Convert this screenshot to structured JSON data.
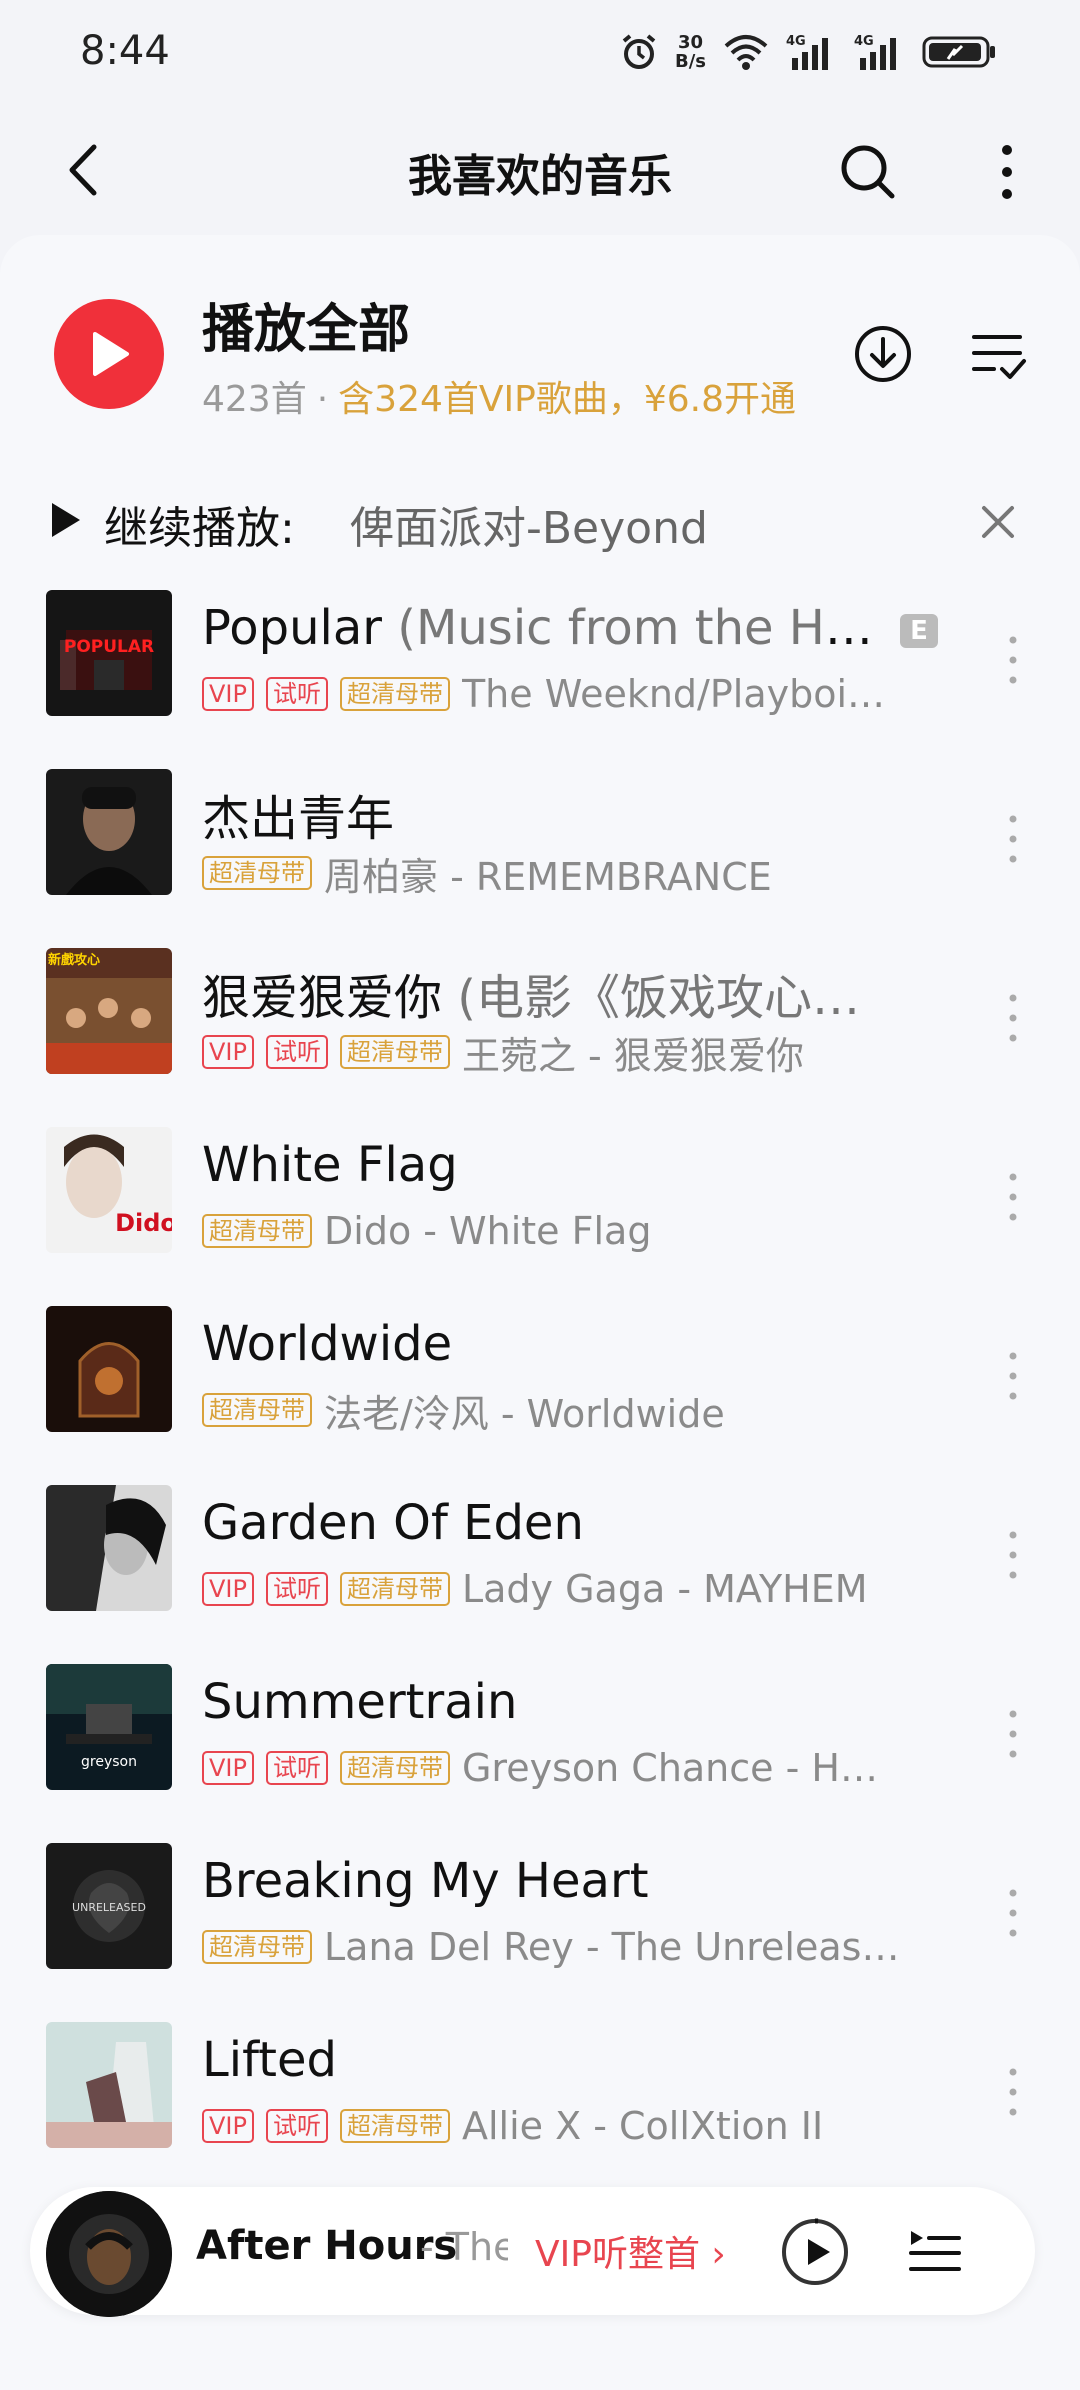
{
  "status_bar": {
    "time": "8:44",
    "net_speed_value": "30",
    "net_speed_unit": "B/s",
    "icons": [
      "alarm-icon",
      "wifi-icon",
      "signal-4g-icon",
      "signal-4g-icon",
      "battery-icon"
    ]
  },
  "nav": {
    "title": "我喜欢的音乐",
    "back_icon": "back-arrow-icon",
    "search_icon": "search-icon",
    "more_icon": "more-vertical-icon"
  },
  "play_all": {
    "title": "播放全部",
    "count": "423首",
    "separator": "·",
    "vip_notice": "含324首VIP歌曲，¥6.8开通"
  },
  "continue": {
    "label": "继续播放:",
    "song": "俾面派对-Beyond"
  },
  "songs": [
    {
      "title": "Popular",
      "extra": " (Music from the HB…",
      "explicit": "E",
      "tags": [
        "VIP",
        "试听",
        "超清母带"
      ],
      "artist": "The Weeknd/Playboi…"
    },
    {
      "title": "杰出青年",
      "extra": "",
      "tags": [
        "超清母带"
      ],
      "artist": "周柏豪 - REMEMBRANCE"
    },
    {
      "title": "狠爱狠爱你",
      "extra": " (电影《饭戏攻心…",
      "tags": [
        "VIP",
        "试听",
        "超清母带"
      ],
      "artist": "王菀之 - 狠爱狠爱你"
    },
    {
      "title": "White Flag",
      "extra": "",
      "tags": [
        "超清母带"
      ],
      "artist": "Dido - White Flag"
    },
    {
      "title": "Worldwide",
      "extra": "",
      "tags": [
        "超清母带"
      ],
      "artist": "法老/泠风 - Worldwide"
    },
    {
      "title": "Garden Of Eden",
      "extra": "",
      "tags": [
        "VIP",
        "试听",
        "超清母带"
      ],
      "artist": "Lady Gaga - MAYHEM"
    },
    {
      "title": "Summertrain",
      "extra": "",
      "tags": [
        "VIP",
        "试听",
        "超清母带"
      ],
      "artist": "Greyson Chance - H…"
    },
    {
      "title": "Breaking My Heart",
      "extra": "",
      "tags": [
        "超清母带"
      ],
      "artist": "Lana Del Rey - The Unreleas…"
    },
    {
      "title": "Lifted",
      "extra": "",
      "tags": [
        "VIP",
        "试听",
        "超清母带"
      ],
      "artist": "Allie X - CollXtion II"
    }
  ],
  "cover_texts": {
    "popular": "POPULAR",
    "xinxi": "新戲攻心",
    "dido": "Dido",
    "greyson": "greyson",
    "unreleased": "UNRELEASED"
  },
  "mini_player": {
    "title": "After Hours",
    "artist": " - The",
    "vip_cta": "VIP听整首 ›"
  },
  "colors": {
    "accent_red": "#f0303a",
    "vip_gold": "#d9a23b",
    "tag_red": "#e8454f"
  }
}
